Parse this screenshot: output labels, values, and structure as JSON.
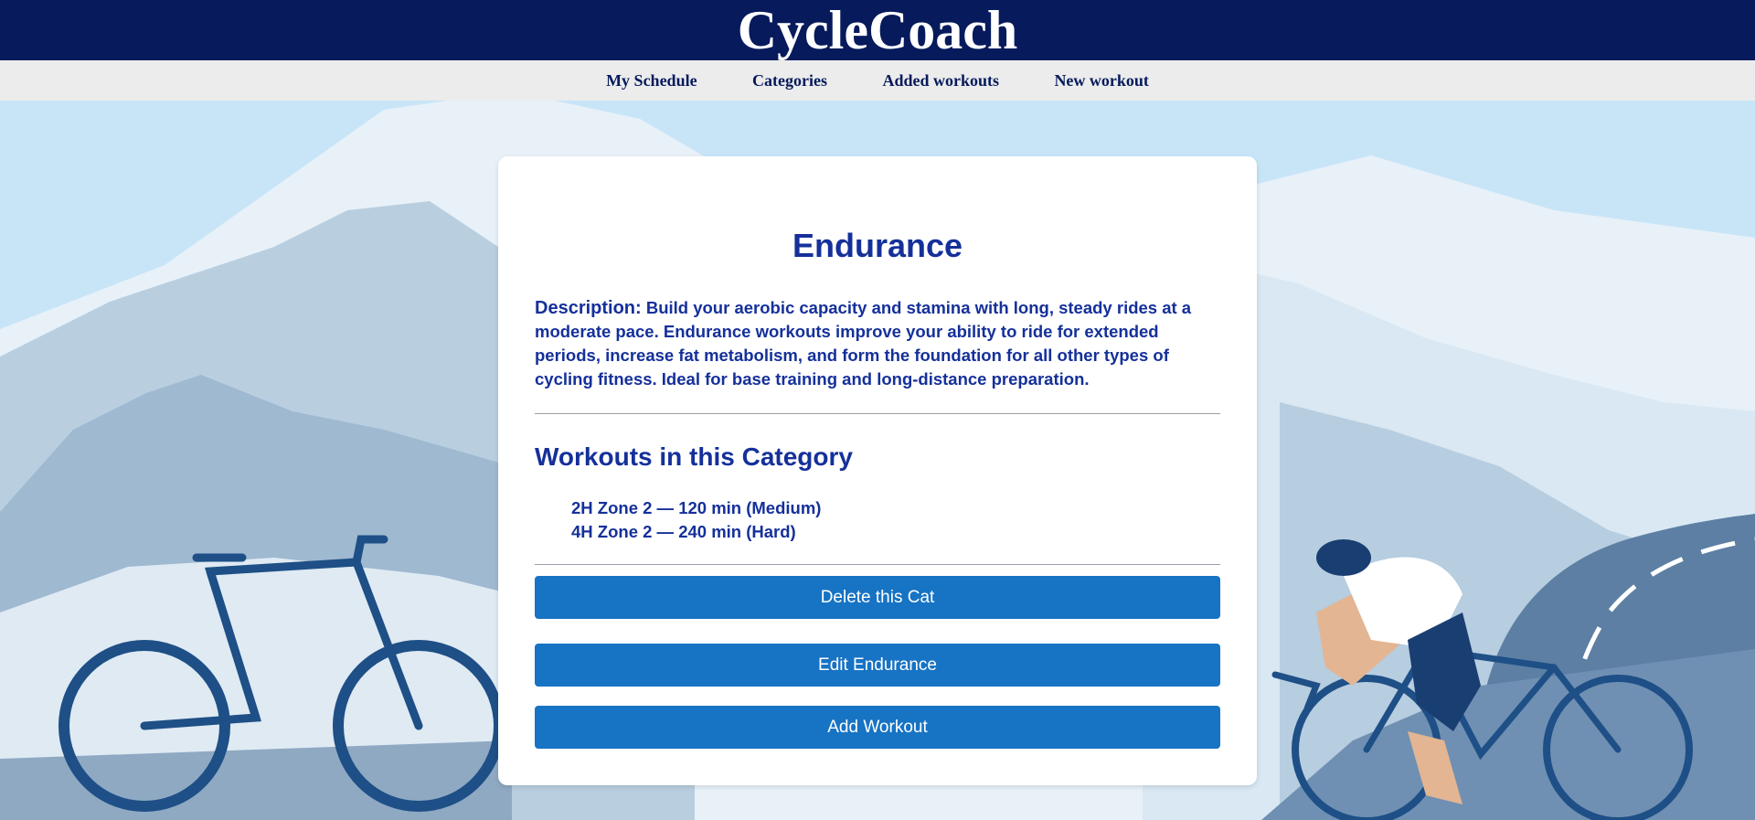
{
  "app": {
    "brand": "CycleCoach"
  },
  "nav": {
    "items": [
      {
        "label": "My Schedule"
      },
      {
        "label": "Categories"
      },
      {
        "label": "Added workouts"
      },
      {
        "label": "New workout"
      }
    ]
  },
  "category": {
    "title": "Endurance",
    "description_label": "Description:",
    "description": "Build your aerobic capacity and stamina with long, steady rides at a moderate pace. Endurance workouts improve your ability to ride for extended periods, increase fat metabolism, and form the foundation for all other types of cycling fitness. Ideal for base training and long-distance preparation.",
    "workouts_heading": "Workouts in this Category",
    "workouts": [
      {
        "label": "2H Zone 2 — 120 min (Medium)"
      },
      {
        "label": "4H Zone 2 — 240 min (Hard)"
      }
    ]
  },
  "actions": {
    "delete_label": "Delete this Cat",
    "edit_label": "Edit Endurance",
    "add_label": "Add Workout"
  },
  "colors": {
    "header_bg": "#061a5c",
    "nav_bg": "#ececec",
    "accent_text": "#15309a",
    "button_bg": "#1773c4"
  }
}
